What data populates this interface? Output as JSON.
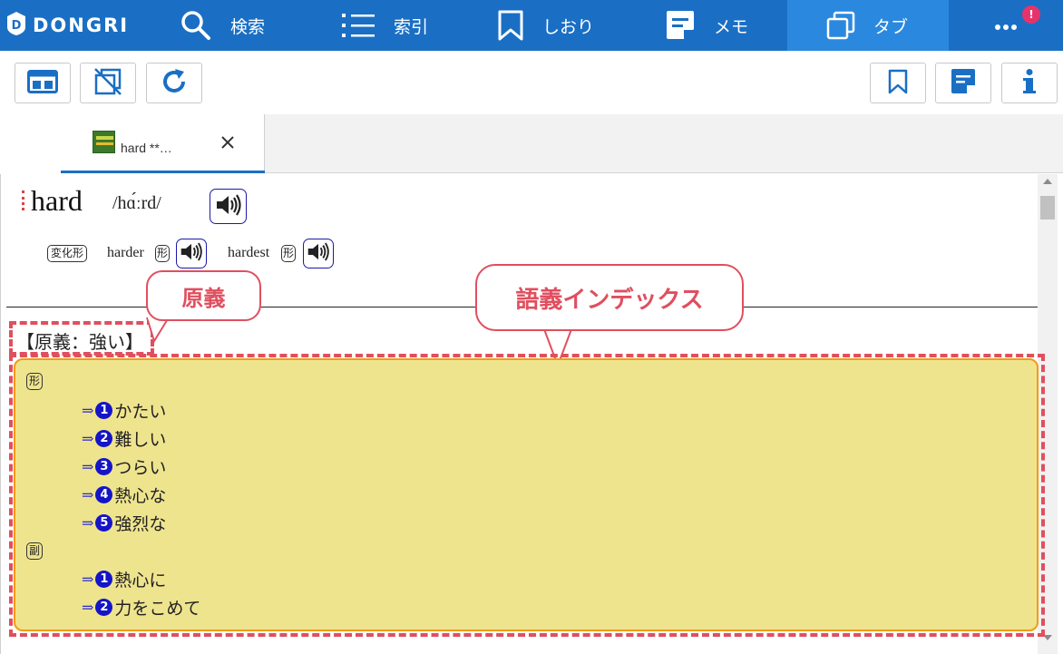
{
  "app": {
    "logo_text": "DONGRI"
  },
  "nav": {
    "search": "検索",
    "index": "索引",
    "bookmark": "しおり",
    "memo": "メモ",
    "tabs": "タブ",
    "more_badge": "!"
  },
  "tab": {
    "label": "hard **…"
  },
  "entry": {
    "headword": "hard",
    "pronunciation": "/hɑ́ːrd/",
    "inflection_label": "変化形",
    "comparative": "harder",
    "comparative_pos": "形",
    "superlative": "hardest",
    "superlative_pos": "形"
  },
  "original_meaning": "【原義：強い】",
  "callouts": {
    "original_meaning": "原義",
    "sense_index": "語義インデックス"
  },
  "index": {
    "groups": [
      {
        "pos": "形",
        "senses": [
          {
            "num": "1",
            "text": "かたい"
          },
          {
            "num": "2",
            "text": "難しい"
          },
          {
            "num": "3",
            "text": "つらい"
          },
          {
            "num": "4",
            "text": "熱心な"
          },
          {
            "num": "5",
            "text": "強烈な"
          }
        ]
      },
      {
        "pos": "副",
        "senses": [
          {
            "num": "1",
            "text": "熱心に"
          },
          {
            "num": "2",
            "text": "力をこめて"
          }
        ]
      }
    ],
    "arrow": "⇒"
  },
  "colors": {
    "nav_bg": "#1a6fc4",
    "nav_active": "#2b88df",
    "callout": "#e04f5f",
    "panel_bg": "#efe48e",
    "panel_border": "#f29a1a",
    "sense_number": "#1414c8"
  },
  "icons": {
    "logo": "dongri-logo-icon",
    "search": "search-icon",
    "index": "list-icon",
    "bookmark": "bookmark-icon",
    "memo": "memo-icon",
    "tabs": "tabs-icon",
    "more": "more-icon",
    "layout": "layout-icon",
    "close_all": "close-all-tabs-icon",
    "refresh": "refresh-icon",
    "add_bookmark": "bookmark-icon",
    "add_memo": "memo-icon",
    "info": "info-icon",
    "speaker": "speaker-icon"
  }
}
